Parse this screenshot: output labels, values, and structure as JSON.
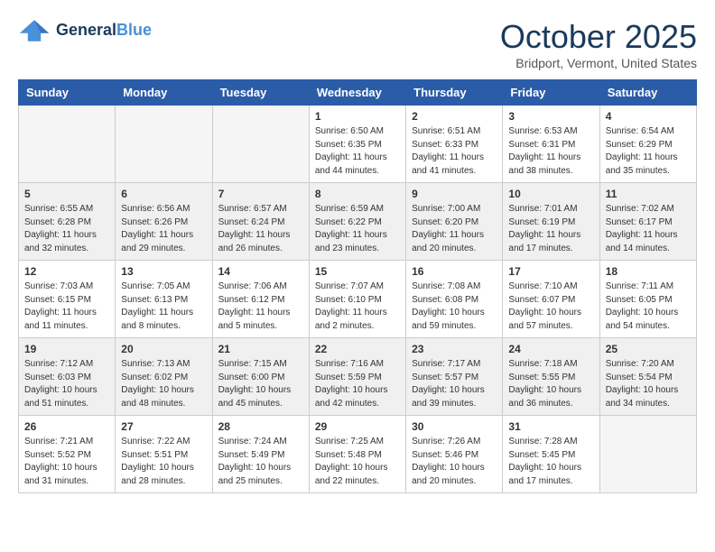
{
  "header": {
    "logo_line1": "General",
    "logo_line2": "Blue",
    "month": "October 2025",
    "location": "Bridport, Vermont, United States"
  },
  "weekdays": [
    "Sunday",
    "Monday",
    "Tuesday",
    "Wednesday",
    "Thursday",
    "Friday",
    "Saturday"
  ],
  "weeks": [
    [
      {
        "day": "",
        "sunrise": "",
        "sunset": "",
        "daylight": "",
        "empty": true
      },
      {
        "day": "",
        "sunrise": "",
        "sunset": "",
        "daylight": "",
        "empty": true
      },
      {
        "day": "",
        "sunrise": "",
        "sunset": "",
        "daylight": "",
        "empty": true
      },
      {
        "day": "1",
        "sunrise": "Sunrise: 6:50 AM",
        "sunset": "Sunset: 6:35 PM",
        "daylight": "Daylight: 11 hours and 44 minutes."
      },
      {
        "day": "2",
        "sunrise": "Sunrise: 6:51 AM",
        "sunset": "Sunset: 6:33 PM",
        "daylight": "Daylight: 11 hours and 41 minutes."
      },
      {
        "day": "3",
        "sunrise": "Sunrise: 6:53 AM",
        "sunset": "Sunset: 6:31 PM",
        "daylight": "Daylight: 11 hours and 38 minutes."
      },
      {
        "day": "4",
        "sunrise": "Sunrise: 6:54 AM",
        "sunset": "Sunset: 6:29 PM",
        "daylight": "Daylight: 11 hours and 35 minutes."
      }
    ],
    [
      {
        "day": "5",
        "sunrise": "Sunrise: 6:55 AM",
        "sunset": "Sunset: 6:28 PM",
        "daylight": "Daylight: 11 hours and 32 minutes."
      },
      {
        "day": "6",
        "sunrise": "Sunrise: 6:56 AM",
        "sunset": "Sunset: 6:26 PM",
        "daylight": "Daylight: 11 hours and 29 minutes."
      },
      {
        "day": "7",
        "sunrise": "Sunrise: 6:57 AM",
        "sunset": "Sunset: 6:24 PM",
        "daylight": "Daylight: 11 hours and 26 minutes."
      },
      {
        "day": "8",
        "sunrise": "Sunrise: 6:59 AM",
        "sunset": "Sunset: 6:22 PM",
        "daylight": "Daylight: 11 hours and 23 minutes."
      },
      {
        "day": "9",
        "sunrise": "Sunrise: 7:00 AM",
        "sunset": "Sunset: 6:20 PM",
        "daylight": "Daylight: 11 hours and 20 minutes."
      },
      {
        "day": "10",
        "sunrise": "Sunrise: 7:01 AM",
        "sunset": "Sunset: 6:19 PM",
        "daylight": "Daylight: 11 hours and 17 minutes."
      },
      {
        "day": "11",
        "sunrise": "Sunrise: 7:02 AM",
        "sunset": "Sunset: 6:17 PM",
        "daylight": "Daylight: 11 hours and 14 minutes."
      }
    ],
    [
      {
        "day": "12",
        "sunrise": "Sunrise: 7:03 AM",
        "sunset": "Sunset: 6:15 PM",
        "daylight": "Daylight: 11 hours and 11 minutes."
      },
      {
        "day": "13",
        "sunrise": "Sunrise: 7:05 AM",
        "sunset": "Sunset: 6:13 PM",
        "daylight": "Daylight: 11 hours and 8 minutes."
      },
      {
        "day": "14",
        "sunrise": "Sunrise: 7:06 AM",
        "sunset": "Sunset: 6:12 PM",
        "daylight": "Daylight: 11 hours and 5 minutes."
      },
      {
        "day": "15",
        "sunrise": "Sunrise: 7:07 AM",
        "sunset": "Sunset: 6:10 PM",
        "daylight": "Daylight: 11 hours and 2 minutes."
      },
      {
        "day": "16",
        "sunrise": "Sunrise: 7:08 AM",
        "sunset": "Sunset: 6:08 PM",
        "daylight": "Daylight: 10 hours and 59 minutes."
      },
      {
        "day": "17",
        "sunrise": "Sunrise: 7:10 AM",
        "sunset": "Sunset: 6:07 PM",
        "daylight": "Daylight: 10 hours and 57 minutes."
      },
      {
        "day": "18",
        "sunrise": "Sunrise: 7:11 AM",
        "sunset": "Sunset: 6:05 PM",
        "daylight": "Daylight: 10 hours and 54 minutes."
      }
    ],
    [
      {
        "day": "19",
        "sunrise": "Sunrise: 7:12 AM",
        "sunset": "Sunset: 6:03 PM",
        "daylight": "Daylight: 10 hours and 51 minutes."
      },
      {
        "day": "20",
        "sunrise": "Sunrise: 7:13 AM",
        "sunset": "Sunset: 6:02 PM",
        "daylight": "Daylight: 10 hours and 48 minutes."
      },
      {
        "day": "21",
        "sunrise": "Sunrise: 7:15 AM",
        "sunset": "Sunset: 6:00 PM",
        "daylight": "Daylight: 10 hours and 45 minutes."
      },
      {
        "day": "22",
        "sunrise": "Sunrise: 7:16 AM",
        "sunset": "Sunset: 5:59 PM",
        "daylight": "Daylight: 10 hours and 42 minutes."
      },
      {
        "day": "23",
        "sunrise": "Sunrise: 7:17 AM",
        "sunset": "Sunset: 5:57 PM",
        "daylight": "Daylight: 10 hours and 39 minutes."
      },
      {
        "day": "24",
        "sunrise": "Sunrise: 7:18 AM",
        "sunset": "Sunset: 5:55 PM",
        "daylight": "Daylight: 10 hours and 36 minutes."
      },
      {
        "day": "25",
        "sunrise": "Sunrise: 7:20 AM",
        "sunset": "Sunset: 5:54 PM",
        "daylight": "Daylight: 10 hours and 34 minutes."
      }
    ],
    [
      {
        "day": "26",
        "sunrise": "Sunrise: 7:21 AM",
        "sunset": "Sunset: 5:52 PM",
        "daylight": "Daylight: 10 hours and 31 minutes."
      },
      {
        "day": "27",
        "sunrise": "Sunrise: 7:22 AM",
        "sunset": "Sunset: 5:51 PM",
        "daylight": "Daylight: 10 hours and 28 minutes."
      },
      {
        "day": "28",
        "sunrise": "Sunrise: 7:24 AM",
        "sunset": "Sunset: 5:49 PM",
        "daylight": "Daylight: 10 hours and 25 minutes."
      },
      {
        "day": "29",
        "sunrise": "Sunrise: 7:25 AM",
        "sunset": "Sunset: 5:48 PM",
        "daylight": "Daylight: 10 hours and 22 minutes."
      },
      {
        "day": "30",
        "sunrise": "Sunrise: 7:26 AM",
        "sunset": "Sunset: 5:46 PM",
        "daylight": "Daylight: 10 hours and 20 minutes."
      },
      {
        "day": "31",
        "sunrise": "Sunrise: 7:28 AM",
        "sunset": "Sunset: 5:45 PM",
        "daylight": "Daylight: 10 hours and 17 minutes."
      },
      {
        "day": "",
        "sunrise": "",
        "sunset": "",
        "daylight": "",
        "empty": true
      }
    ]
  ]
}
